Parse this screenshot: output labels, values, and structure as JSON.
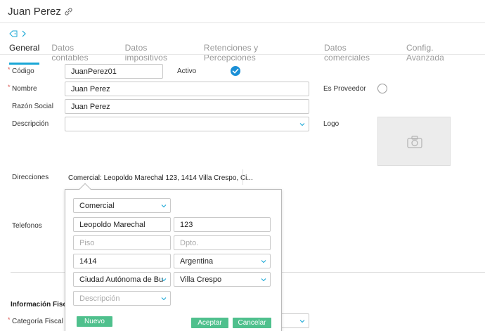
{
  "header": {
    "title": "Juan Perez",
    "link_icon": "link-icon"
  },
  "tabs": [
    {
      "label": "General",
      "active": true
    },
    {
      "label": "Datos contables",
      "active": false
    },
    {
      "label": "Datos impositivos",
      "active": false
    },
    {
      "label": "Retenciones y Percepciones",
      "active": false
    },
    {
      "label": "Datos comerciales",
      "active": false
    },
    {
      "label": "Config. Avanzada",
      "active": false
    }
  ],
  "form": {
    "codigo_label": "Código",
    "codigo_value": "JuanPerez01",
    "activo_label": "Activo",
    "nombre_label": "Nombre",
    "nombre_value": "Juan Perez",
    "es_proveedor_label": "Es Proveedor",
    "razon_social_label": "Razón Social",
    "razon_social_value": "Juan Perez",
    "descripcion_label": "Descripción",
    "descripcion_value": "",
    "logo_label": "Logo",
    "direcciones_label": "Direcciones",
    "direccion_summary": "Comercial: Leopoldo Marechal 123, 1414 Villa Crespo, Ci...",
    "telefonos_label": "Telefonos",
    "info_fiscal_label": "Información Fisc",
    "categoria_fiscal_label": "Categoría Fiscal",
    "required_mark": "*"
  },
  "address_popup": {
    "tipo": "Comercial",
    "calle": "Leopoldo Marechal",
    "numero": "123",
    "piso_placeholder": "Piso",
    "dpto_placeholder": "Dpto.",
    "codigo_postal": "1414",
    "pais": "Argentina",
    "provincia": "Ciudad Autónoma de Bu",
    "localidad": "Villa Crespo",
    "descripcion_placeholder": "Descripción",
    "nuevo_label": "Nuevo",
    "aceptar_label": "Aceptar",
    "cancelar_label": "Cancelar"
  },
  "colors": {
    "accent": "#1aa7d6",
    "check": "#1a8fd6",
    "button": "#4fc08d",
    "required": "#d9534f"
  }
}
